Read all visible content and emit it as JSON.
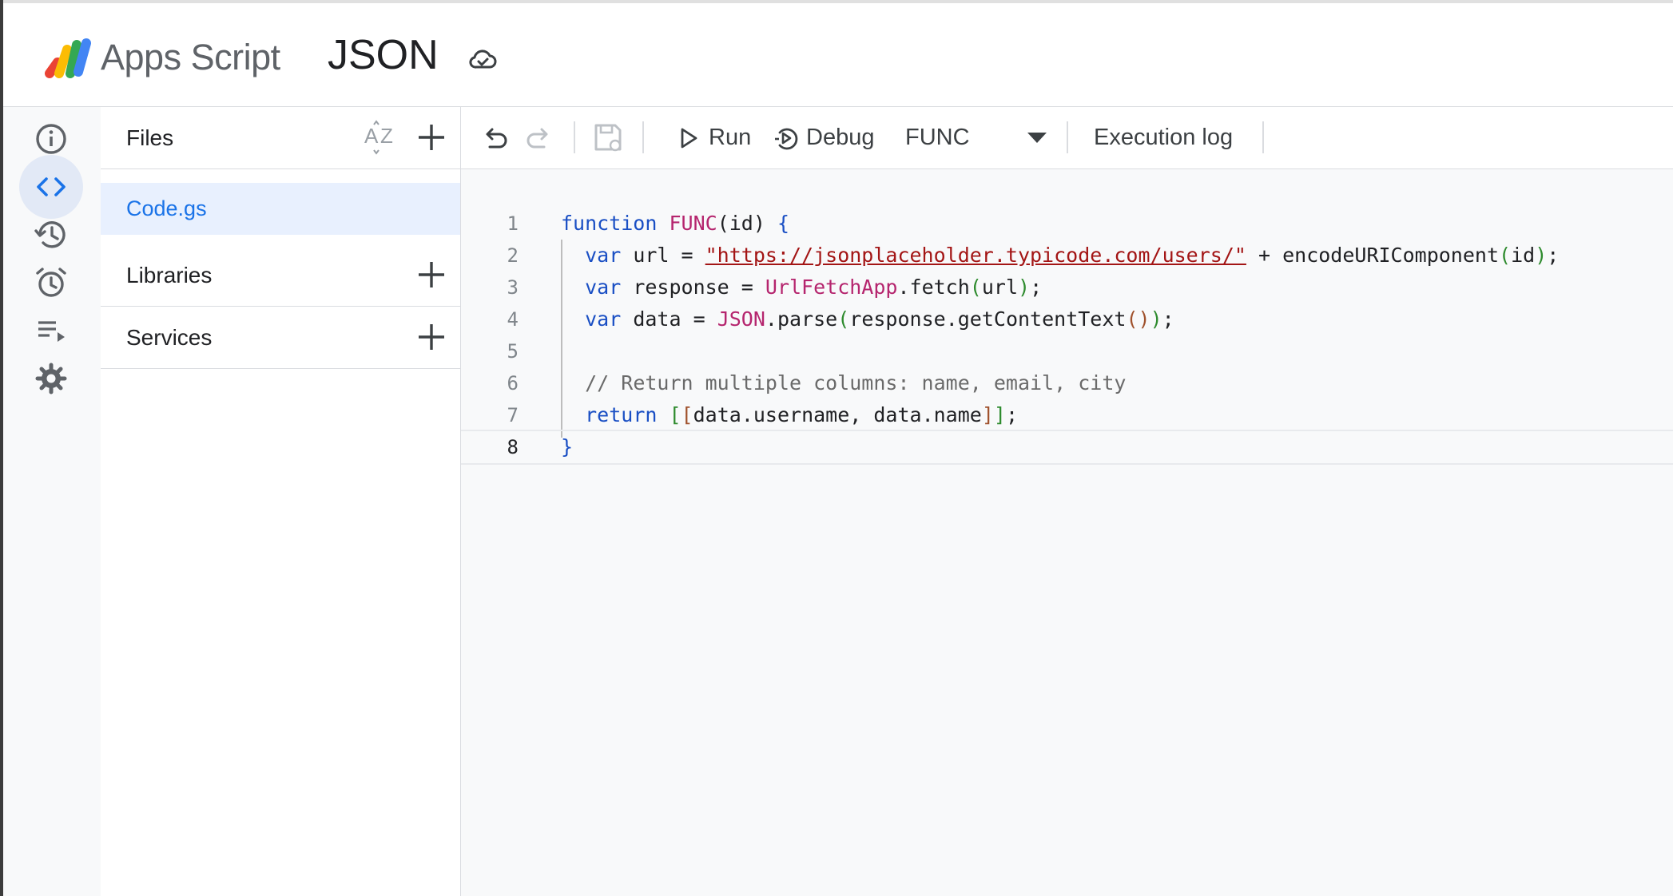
{
  "header": {
    "app_name": "Apps Script",
    "project_title": "JSON"
  },
  "rail": {
    "items": [
      {
        "name": "overview",
        "icon": "info-icon"
      },
      {
        "name": "editor",
        "icon": "code-icon",
        "active": true
      },
      {
        "name": "executions",
        "icon": "history-icon"
      },
      {
        "name": "triggers",
        "icon": "alarm-icon"
      },
      {
        "name": "executions-list",
        "icon": "playlist-play-icon"
      },
      {
        "name": "project-settings",
        "icon": "gear-icon"
      }
    ]
  },
  "files_panel": {
    "files_label": "Files",
    "files": [
      {
        "name": "Code.gs"
      }
    ],
    "libraries_label": "Libraries",
    "services_label": "Services"
  },
  "toolbar": {
    "run_label": "Run",
    "debug_label": "Debug",
    "function_selected": "FUNC",
    "execution_log_label": "Execution log"
  },
  "editor": {
    "lines": [
      {
        "num": "1",
        "text": "function FUNC(id) {"
      },
      {
        "num": "2",
        "text": "  var url = \"https://jsonplaceholder.typicode.com/users/\" + encodeURIComponent(id);"
      },
      {
        "num": "3",
        "text": "  var response = UrlFetchApp.fetch(url);"
      },
      {
        "num": "4",
        "text": "  var data = JSON.parse(response.getContentText());"
      },
      {
        "num": "5",
        "text": ""
      },
      {
        "num": "6",
        "text": "  // Return multiple columns: name, email, city"
      },
      {
        "num": "7",
        "text": "  return [[data.username, data.name]];"
      },
      {
        "num": "8",
        "text": "}"
      }
    ],
    "current_line": 8,
    "tokens": {
      "l1_kw": "function",
      "l1_fn": "FUNC",
      "l1_rest": "(id) ",
      "l2_var": "var",
      "l2_a": " url = ",
      "l2_str": "\"https://jsonplaceholder.typicode.com/users/\"",
      "l2_b": " + encodeURIComponent",
      "l2_c": "id",
      "l2_end": ";",
      "l3_var": "var",
      "l3_a": " response = ",
      "l3_cls": "UrlFetchApp",
      "l3_b": ".fetch",
      "l3_c": "url",
      "l3_end": ";",
      "l4_var": "var",
      "l4_a": " data = ",
      "l4_cls": "JSON",
      "l4_b": ".parse",
      "l4_c": "response.getContentText",
      "l4_end": ";",
      "l6_comment": "// Return multiple columns: name, email, city",
      "l7_kw": "return",
      "l7_c": "data.username, data.name",
      "l7_end": ";"
    }
  },
  "colors": {
    "keyword": "#1a4fc4",
    "function_name": "#b5256e",
    "string": "#a31515",
    "comment": "#6a6a6a",
    "active_blue": "#1a73e8",
    "selected_bg": "#e8f0fe"
  }
}
